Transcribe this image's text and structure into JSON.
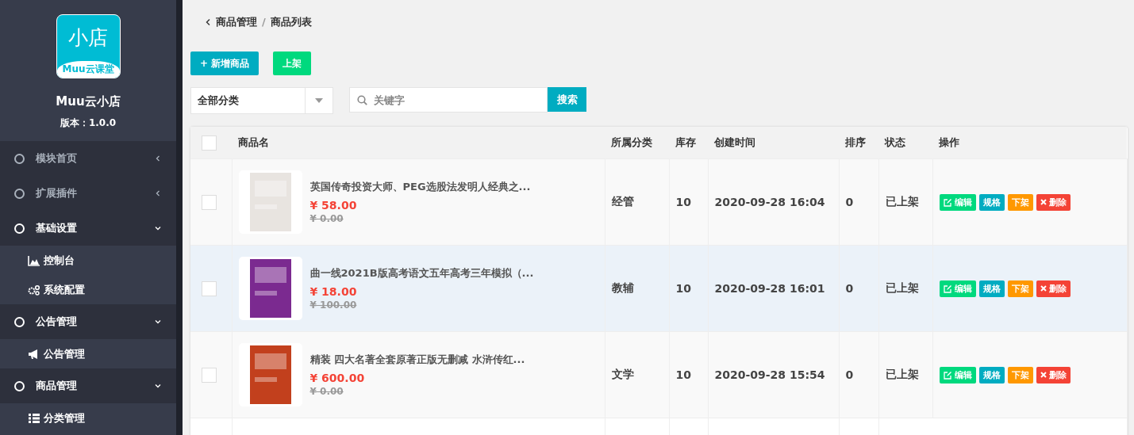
{
  "sidebar": {
    "logo": {
      "title": "小店",
      "subtitle": "Muu云课堂"
    },
    "app_name": "Muu云小店",
    "version": "版本：1.0.0",
    "menu": [
      {
        "label": "模块首页",
        "expanded": false
      },
      {
        "label": "扩展插件",
        "expanded": false
      },
      {
        "label": "基础设置",
        "expanded": true,
        "children": [
          {
            "label": "控制台",
            "kind": "chart"
          },
          {
            "label": "系统配置",
            "kind": "gears"
          }
        ]
      },
      {
        "label": "公告管理",
        "expanded": true,
        "children": [
          {
            "label": "公告管理",
            "kind": "bullhorn"
          }
        ]
      },
      {
        "label": "商品管理",
        "expanded": true,
        "children": [
          {
            "label": "分类管理",
            "kind": "list"
          }
        ]
      }
    ]
  },
  "breadcrumb": {
    "items": [
      "商品管理",
      "商品列表"
    ],
    "separator": "/"
  },
  "toolbar": {
    "add_button": "+ 新增商品",
    "publish_button": "上架"
  },
  "filters": {
    "category_select": "全部分类",
    "search": {
      "placeholder": "关键字"
    },
    "search_button": "搜索"
  },
  "table": {
    "columns": [
      "商品名",
      "所属分类",
      "库存",
      "创建时间",
      "排序",
      "状态",
      "操作"
    ],
    "select_all_checked": false,
    "rows": [
      {
        "name": "英国传奇投资大师、PEG选股法发明人经典之...",
        "price": "¥ 58.00",
        "original_price": "¥ 0.00",
        "category": "经管",
        "stock": "10",
        "created": "2020-09-28 16:04",
        "sort": "0",
        "status": "已上架",
        "actions": [
          "编辑",
          "规格",
          "下架",
          "删除"
        ],
        "checked": false,
        "highlighted": false
      },
      {
        "name": "曲一线2021B版高考语文五年高考三年模拟（...",
        "price": "¥ 18.00",
        "original_price": "¥ 100.00",
        "category": "教辅",
        "stock": "10",
        "created": "2020-09-28 16:01",
        "sort": "0",
        "status": "已上架",
        "actions": [
          "编辑",
          "规格",
          "下架",
          "删除"
        ],
        "checked": false,
        "highlighted": true
      },
      {
        "name": "精装 四大名著全套原著正版无删减 水浒传红...",
        "price": "¥ 600.00",
        "original_price": "¥ 0.00",
        "category": "文学",
        "stock": "10",
        "created": "2020-09-28 15:54",
        "sort": "0",
        "status": "已上架",
        "actions": [
          "编辑",
          "规格",
          "下架",
          "删除"
        ],
        "checked": false,
        "highlighted": false
      }
    ]
  }
}
